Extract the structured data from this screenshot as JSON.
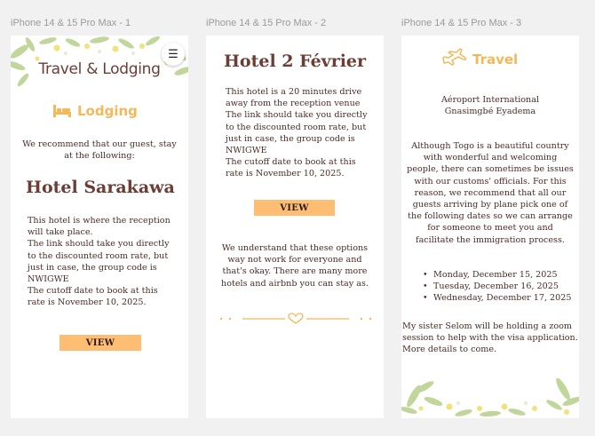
{
  "frames": [
    {
      "label": "iPhone 14 & 15 Pro Max - 1"
    },
    {
      "label": "iPhone 14 & 15 Pro Max - 2"
    },
    {
      "label": "iPhone 14 & 15 Pro Max - 3"
    }
  ],
  "screen1": {
    "brand_title": "Travel & Lodging",
    "menu_icon": "hamburger-menu-icon",
    "tab_label": "Lodging",
    "tab_icon": "bed-icon",
    "intro": "We recommend that our guest, stay at the following:",
    "hotel_name": "Hotel Sarakawa",
    "lines": [
      "This hotel is where the reception",
      "will take place.",
      "The link should take you directly",
      "to the discounted room rate, but",
      "just in case, the group code is",
      "NWIGWE",
      "The cutoff date to book at this",
      "rate is November 10, 2025."
    ],
    "view_label": "VIEW"
  },
  "screen2": {
    "hotel_name": "Hotel 2 Février",
    "lines": [
      "This hotel is a 20 minutes drive",
      "away from the reception venue",
      "The link should take you directly",
      "to the discounted room rate, but",
      "just in case, the group code is",
      "NWIGWE",
      "The cutoff date to book at this",
      "rate is November 10, 2025."
    ],
    "view_label": "VIEW",
    "note_lines": [
      "We understand that these options",
      "way not work for everyone and",
      "that's okay. There are many more",
      "hotels and airbnb you can stay as."
    ],
    "divider_icon": "heart-icon"
  },
  "screen3": {
    "tab_label": "Travel",
    "tab_icon": "airplane-icon",
    "airport_lines": [
      "Aéroport International",
      "Gnasimgbé Eyadema"
    ],
    "para_lines": [
      "Although Togo is a beautiful country",
      "with wonderful and welcoming",
      "people, there can sometimes be issues",
      "with our customs' officials. For this",
      "reason, we recommend that all our",
      "guests arriving by plane pick one of",
      "the following dates so we can arrange",
      "for someone to meet you and",
      "facilitate the immigration process."
    ],
    "dates": [
      "Monday, December 15, 2025",
      "Tuesday, December 16, 2025",
      "Wednesday, December 17, 2025"
    ],
    "closing_lines": [
      "My sister Selom will be holding a zoom",
      "session to help with the visa application.",
      "More details to come."
    ]
  },
  "colors": {
    "brand_brown": "#6b3d34",
    "accent_orange": "#f2b85a",
    "button_fill": "#fdbe74",
    "foliage_green": "#b7cf8a",
    "flower_yellow": "#f3e27a"
  }
}
